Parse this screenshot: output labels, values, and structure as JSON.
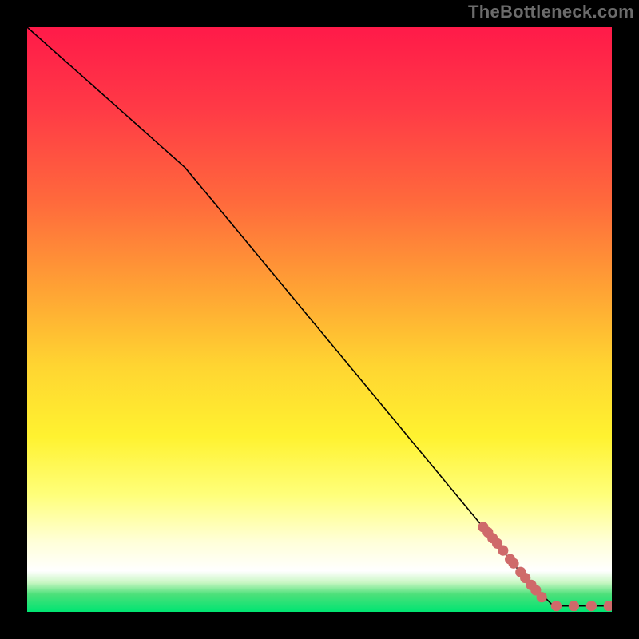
{
  "watermark": "TheBottleneck.com",
  "chart_data": {
    "type": "line",
    "title": "",
    "xlabel": "",
    "ylabel": "",
    "xlim": [
      0,
      100
    ],
    "ylim": [
      0,
      100
    ],
    "grid": false,
    "legend": false,
    "background_gradient": {
      "direction": "vertical",
      "stops": [
        {
          "pos": 0.0,
          "color": "#ff1a49"
        },
        {
          "pos": 0.14,
          "color": "#ff3a46"
        },
        {
          "pos": 0.3,
          "color": "#ff6a3c"
        },
        {
          "pos": 0.45,
          "color": "#ffa334"
        },
        {
          "pos": 0.58,
          "color": "#ffd531"
        },
        {
          "pos": 0.7,
          "color": "#fff230"
        },
        {
          "pos": 0.8,
          "color": "#ffff7a"
        },
        {
          "pos": 0.88,
          "color": "#ffffd8"
        },
        {
          "pos": 0.93,
          "color": "#ffffff"
        },
        {
          "pos": 0.95,
          "color": "#c9f7c4"
        },
        {
          "pos": 0.97,
          "color": "#4de07a"
        },
        {
          "pos": 1.0,
          "color": "#00e472"
        }
      ]
    },
    "curve_color": "#000000",
    "curve": [
      {
        "x": 0,
        "y": 100
      },
      {
        "x": 27,
        "y": 76
      },
      {
        "x": 85,
        "y": 6
      },
      {
        "x": 90,
        "y": 1
      },
      {
        "x": 100,
        "y": 1
      }
    ],
    "markers": {
      "color": "#cf6a6a",
      "radius_frac": 0.009,
      "points": [
        {
          "x": 78.0,
          "y": 14.5
        },
        {
          "x": 78.8,
          "y": 13.6
        },
        {
          "x": 79.6,
          "y": 12.6
        },
        {
          "x": 80.4,
          "y": 11.7
        },
        {
          "x": 81.4,
          "y": 10.5
        },
        {
          "x": 82.6,
          "y": 9.0
        },
        {
          "x": 83.2,
          "y": 8.3
        },
        {
          "x": 84.4,
          "y": 6.8
        },
        {
          "x": 85.2,
          "y": 5.8
        },
        {
          "x": 86.2,
          "y": 4.6
        },
        {
          "x": 87.0,
          "y": 3.7
        },
        {
          "x": 88.0,
          "y": 2.5
        },
        {
          "x": 90.5,
          "y": 1.0
        },
        {
          "x": 93.5,
          "y": 1.0
        },
        {
          "x": 96.5,
          "y": 1.0
        },
        {
          "x": 99.5,
          "y": 1.0
        }
      ]
    }
  }
}
